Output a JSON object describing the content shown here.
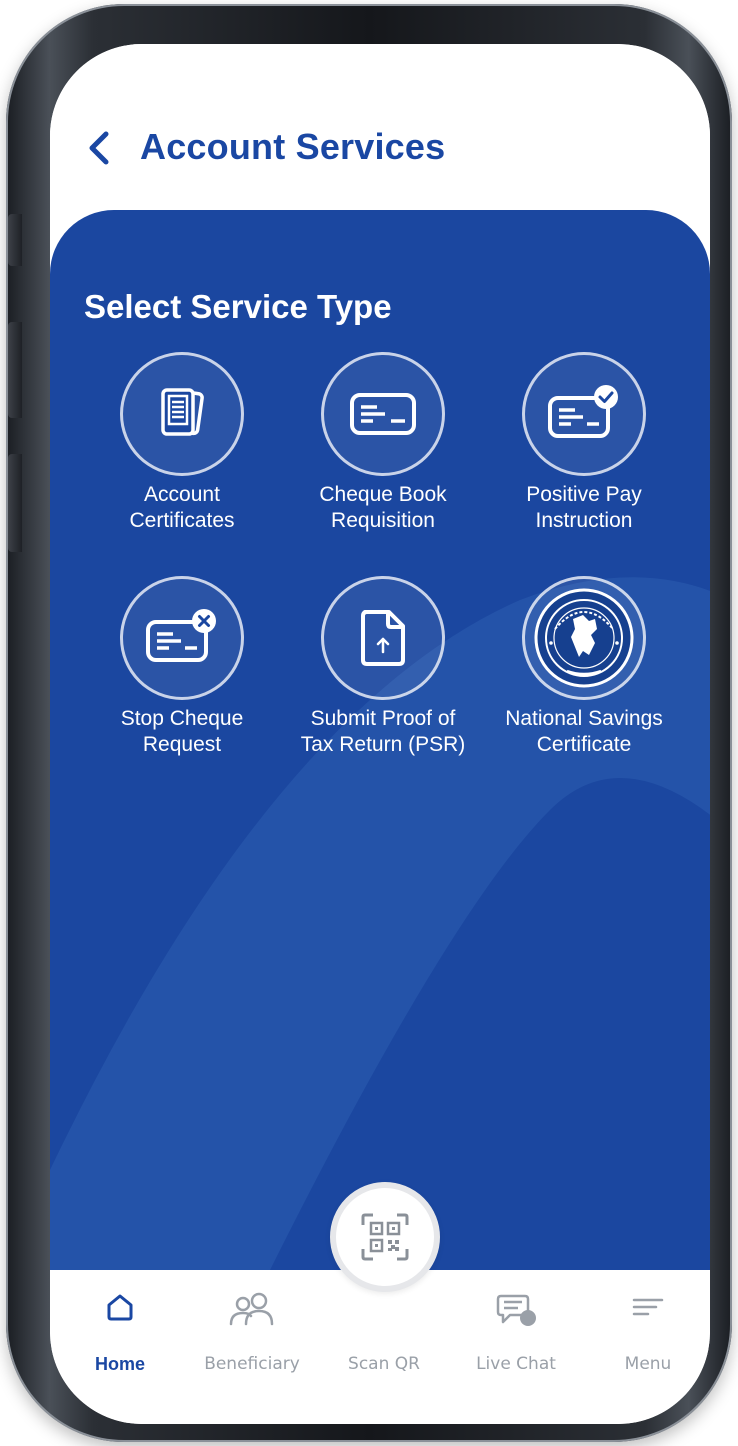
{
  "header": {
    "title": "Account Services"
  },
  "panel": {
    "section_title": "Select Service Type"
  },
  "services": [
    {
      "line1": "Account",
      "line2": "Certificates",
      "icon": "document-stack-icon"
    },
    {
      "line1": "Cheque Book",
      "line2": "Requisition",
      "icon": "cheque-icon"
    },
    {
      "line1": "Positive Pay",
      "line2": "Instruction",
      "icon": "cheque-check-icon"
    },
    {
      "line1": "Stop Cheque",
      "line2": "Request",
      "icon": "cheque-cancel-icon"
    },
    {
      "line1": "Submit Proof of",
      "line2": "Tax Return (PSR)",
      "icon": "file-upload-icon"
    },
    {
      "line1": "National Savings",
      "line2": "Certificate",
      "icon": "national-seal-icon"
    }
  ],
  "nav": {
    "items": [
      {
        "label": "Home",
        "icon": "home-icon",
        "active": true
      },
      {
        "label": "Beneficiary",
        "icon": "people-icon"
      },
      {
        "label": "Scan QR",
        "icon": "qr-code-icon"
      },
      {
        "label": "Live Chat",
        "icon": "chat-icon"
      },
      {
        "label": "Menu",
        "icon": "menu-icon"
      }
    ]
  },
  "colors": {
    "brand_blue": "#1b47a0",
    "title_blue": "#1a47a3",
    "nav_inactive": "#9aa0a8"
  }
}
